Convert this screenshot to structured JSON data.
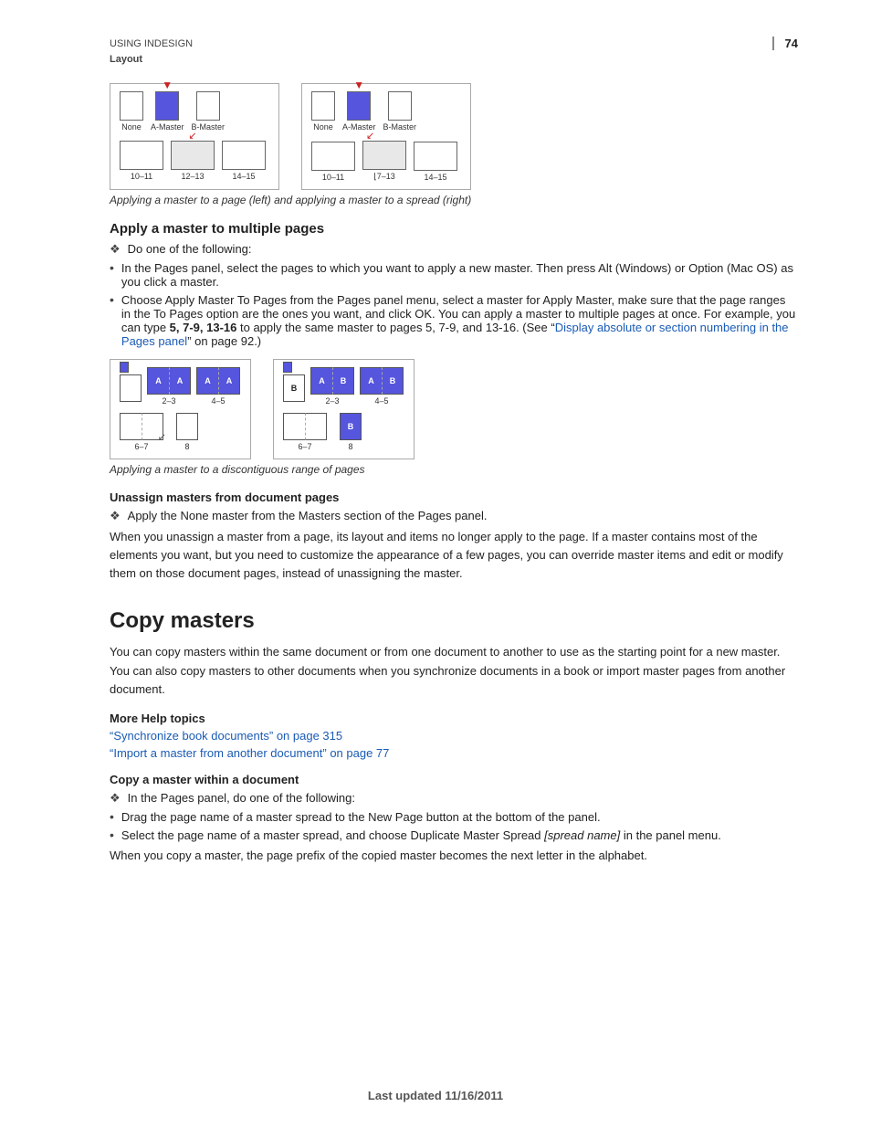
{
  "header": {
    "breadcrumb_line1": "USING INDESIGN",
    "breadcrumb_line2": "Layout",
    "page_number": "74"
  },
  "diagram1": {
    "caption": "Applying a master to a page (left) and applying a master to a spread (right)"
  },
  "section_apply_multiple": {
    "heading": "Apply a master to multiple pages",
    "diamond_item": "Do one of the following:",
    "bullet1": "In the Pages panel, select the pages to which you want to apply a new master. Then press Alt (Windows) or Option (Mac OS) as you click a master.",
    "bullet2_start": "Choose Apply Master To Pages from the Pages panel menu, select a master for Apply Master, make sure that the page ranges in the To Pages option are the ones you want, and click OK. You can apply a master to multiple pages at once. For example, you can type ",
    "bullet2_bold": "5, 7-9, 13-16",
    "bullet2_mid": " to apply the same master to pages 5, 7-9, and 13-16. (See “",
    "bullet2_link": "Display absolute or section numbering in the Pages panel",
    "bullet2_end": "” on page 92.)"
  },
  "diagram2": {
    "caption": "Applying a master to a discontiguous range of pages"
  },
  "section_unassign": {
    "heading": "Unassign masters from document pages",
    "diamond_item": "Apply the None master from the Masters section of the Pages panel.",
    "paragraph": "When you unassign a master from a page, its layout and items no longer apply to the page. If a master contains most of the elements you want, but you need to customize the appearance of a few pages, you can override master items and edit or modify them on those document pages, instead of unassigning the master."
  },
  "section_copy_masters": {
    "main_heading": "Copy masters",
    "paragraph": "You can copy masters within the same document or from one document to another to use as the starting point for a new master. You can also copy masters to other documents when you synchronize documents in a book or import master pages from another document.",
    "more_help_label": "More Help topics",
    "link1_text": "“Synchronize book documents” on page 315",
    "link2_text": "“Import a master from another document” on page 77",
    "subheading": "Copy a master within a document",
    "diamond_item": "In the Pages panel, do one of the following:",
    "bullet1": "Drag the page name of a master spread to the New Page button at the bottom of the panel.",
    "bullet2": "Select the page name of a master spread, and choose Duplicate Master Spread ",
    "bullet2_italic": "[spread name]",
    "bullet2_end": " in the panel menu.",
    "last_para": "When you copy a master, the page prefix of the copied master becomes the next letter in the alphabet."
  },
  "footer": {
    "text": "Last updated 11/16/2011"
  }
}
